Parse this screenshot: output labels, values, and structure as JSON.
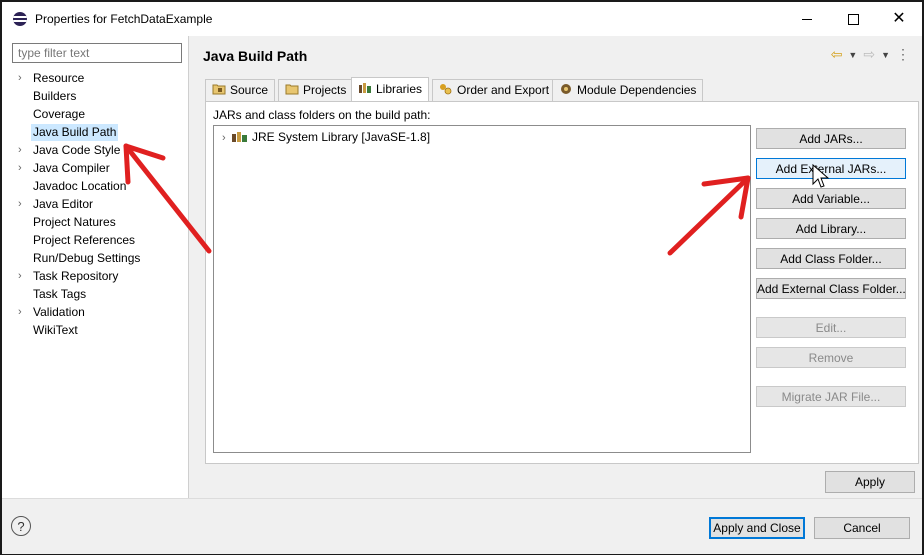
{
  "window": {
    "title": "Properties for FetchDataExample",
    "minimize_icon": "minimize-icon",
    "maximize_icon": "maximize-icon",
    "close_icon": "close-icon",
    "close_glyph": "✕"
  },
  "filter": {
    "placeholder": "type filter text",
    "value": ""
  },
  "tree": {
    "arrow_glyph": "›",
    "items": [
      {
        "label": "Resource",
        "expandable": true
      },
      {
        "label": "Builders",
        "expandable": false
      },
      {
        "label": "Coverage",
        "expandable": false
      },
      {
        "label": "Java Build Path",
        "expandable": false,
        "selected": true
      },
      {
        "label": "Java Code Style",
        "expandable": true
      },
      {
        "label": "Java Compiler",
        "expandable": true
      },
      {
        "label": "Javadoc Location",
        "expandable": false
      },
      {
        "label": "Java Editor",
        "expandable": true
      },
      {
        "label": "Project Natures",
        "expandable": false
      },
      {
        "label": "Project References",
        "expandable": false
      },
      {
        "label": "Run/Debug Settings",
        "expandable": false
      },
      {
        "label": "Task Repository",
        "expandable": true
      },
      {
        "label": "Task Tags",
        "expandable": false
      },
      {
        "label": "Validation",
        "expandable": true
      },
      {
        "label": "WikiText",
        "expandable": false
      }
    ]
  },
  "page": {
    "title": "Java Build Path",
    "nav": {
      "back_glyph": "⇦",
      "forward_glyph": "⇨",
      "dropdown_glyph": "▼",
      "more_glyph": "⋮"
    }
  },
  "tabs": [
    {
      "label": "Source",
      "icon": "source-folder-icon"
    },
    {
      "label": "Projects",
      "icon": "projects-folder-icon"
    },
    {
      "label": "Libraries",
      "icon": "libraries-icon",
      "active": true
    },
    {
      "label": "Order and Export",
      "icon": "order-export-icon"
    },
    {
      "label": "Module Dependencies",
      "icon": "module-dependencies-icon"
    }
  ],
  "libraries": {
    "label": "JARs and class folders on the build path:",
    "entries": [
      {
        "label": "JRE System Library [JavaSE-1.8]",
        "icon": "jar-library-icon"
      }
    ],
    "arrow_glyph": "›"
  },
  "buttons": [
    {
      "label": "Add JARs...",
      "enabled": true
    },
    {
      "label": "Add External JARs...",
      "enabled": true,
      "hover": true
    },
    {
      "label": "Add Variable...",
      "enabled": true
    },
    {
      "label": "Add Library...",
      "enabled": true
    },
    {
      "label": "Add Class Folder...",
      "enabled": true
    },
    {
      "label": "Add External Class Folder...",
      "enabled": true
    },
    {
      "label": "Edit...",
      "enabled": false
    },
    {
      "label": "Remove",
      "enabled": false
    },
    {
      "label": "Migrate JAR File...",
      "enabled": false
    }
  ],
  "apply_label": "Apply",
  "footer": {
    "help_glyph": "?",
    "apply_close_label": "Apply and Close",
    "cancel_label": "Cancel"
  },
  "colors": {
    "selection": "#cce8ff",
    "annotation_arrow": "#e02020",
    "focus_border": "#0078d7"
  }
}
